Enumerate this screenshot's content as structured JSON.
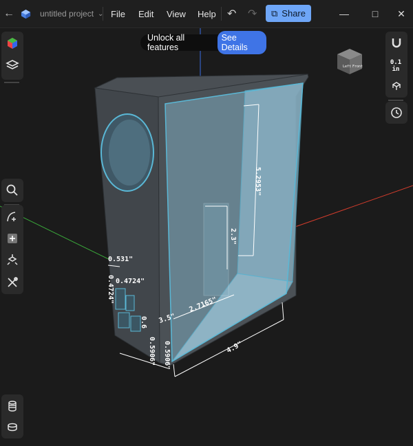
{
  "titlebar": {
    "project_name": "untitled project",
    "menus": [
      "File",
      "Edit",
      "View",
      "Help"
    ],
    "share_label": "Share"
  },
  "banner": {
    "text": "Unlock all features",
    "button_label": "See Details"
  },
  "view_cube": {
    "left_face": "Left",
    "front_face": "Front"
  },
  "grid_unit": {
    "value": "0.1",
    "unit": "in"
  },
  "dimensions": {
    "height_main": "5.2953\"",
    "inner_height": "2.3\"",
    "inner_width": "2.7165\"",
    "bottom_width": "4.9\"",
    "depth_small": "0.531\"",
    "d1": "0.4724\"",
    "d2": "0.4724\"",
    "d3": "3.5\"",
    "d4": "0.5906\"",
    "d5": "0.5906\"",
    "d6": "0.6"
  },
  "colors": {
    "accent": "#6ea6f7",
    "banner_button": "#3f74e6",
    "selection": "#5ab8d6",
    "axis_x": "#d23c2c",
    "axis_y": "#3aa83a",
    "axis_z": "#3a6ee6"
  }
}
